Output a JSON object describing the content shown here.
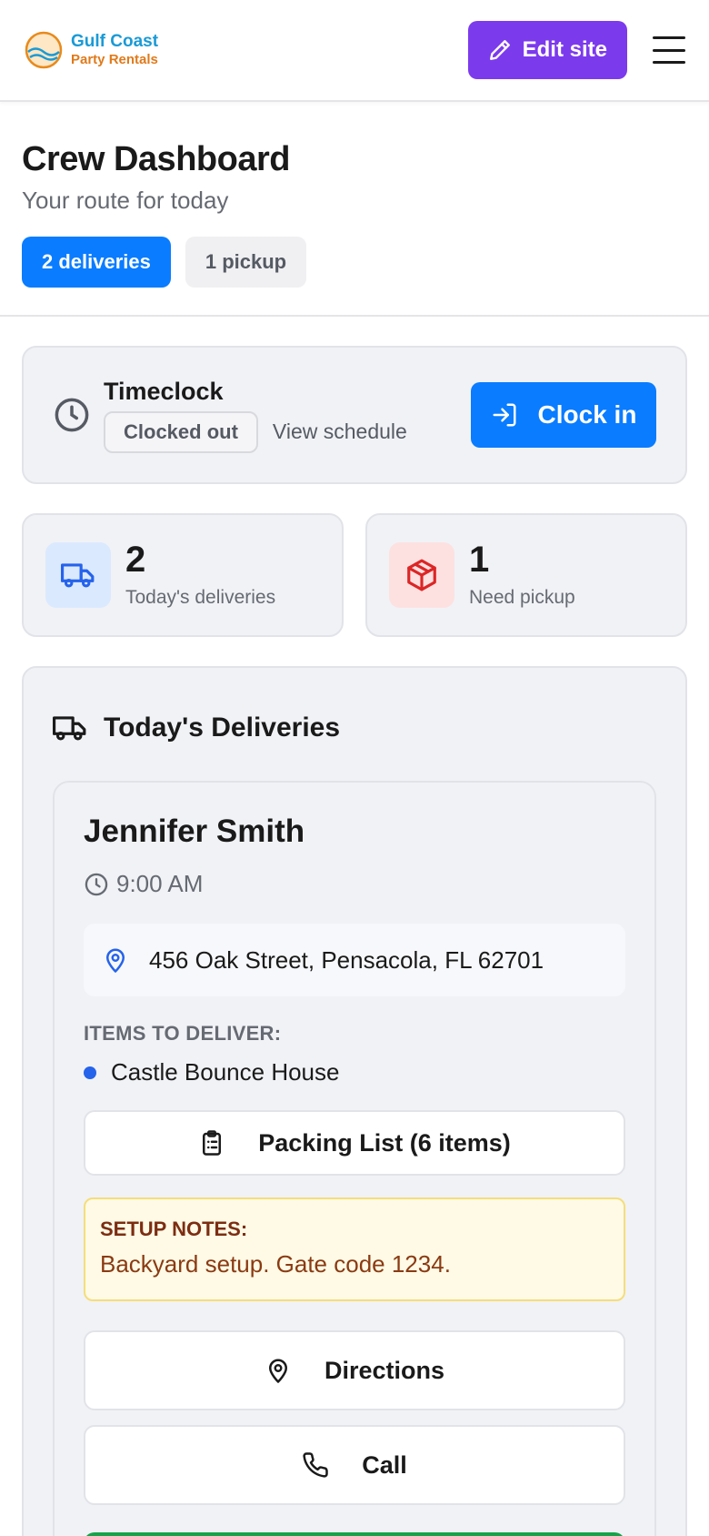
{
  "header": {
    "brand_line1": "Gulf Coast",
    "brand_line2": "Party Rentals",
    "edit_label": "Edit site"
  },
  "page": {
    "title": "Crew Dashboard",
    "subtitle": "Your route for today",
    "chips": [
      {
        "label": "2 deliveries",
        "active": true
      },
      {
        "label": "1 pickup",
        "active": false
      }
    ]
  },
  "timeclock": {
    "title": "Timeclock",
    "status": "Clocked out",
    "schedule_link": "View schedule",
    "clock_in_label": "Clock in"
  },
  "stats": [
    {
      "value": "2",
      "label": "Today's deliveries",
      "icon": "truck-icon",
      "color": "#2563eb"
    },
    {
      "value": "1",
      "label": "Need pickup",
      "icon": "package-icon",
      "color": "#dc2626"
    }
  ],
  "deliveries": {
    "section_title": "Today's Deliveries",
    "jobs": [
      {
        "customer": "Jennifer Smith",
        "time": "9:00 AM",
        "address": "456 Oak Street, Pensacola, FL 62701",
        "items_label": "ITEMS TO DELIVER:",
        "items": [
          "Castle Bounce House"
        ],
        "packing_label": "Packing List (6 items)",
        "notes_label": "SETUP NOTES:",
        "notes_text": "Backyard setup. Gate code 1234.",
        "directions_label": "Directions",
        "call_label": "Call"
      }
    ]
  },
  "colors": {
    "primary": "#0a7cff",
    "edit": "#7c3aed",
    "success": "#16a34a"
  }
}
